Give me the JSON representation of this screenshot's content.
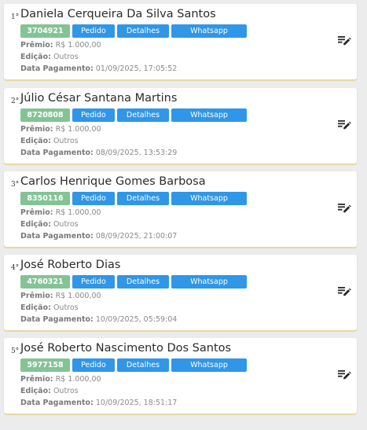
{
  "buttons": {
    "pedido": "Pedido",
    "detalhes": "Detalhes",
    "whatsapp": "Whatsapp"
  },
  "labels": {
    "premio": "Prêmio:",
    "edicao": "Edição:",
    "data_pagamento": "Data Pagamento:"
  },
  "colors": {
    "code_badge": "#83c395",
    "button": "#2f96e8",
    "card_bottom_border": "#e7d9a6"
  },
  "icons": {
    "edit": "playlist-edit-icon"
  },
  "winners": [
    {
      "rank": "1°",
      "name": "Daniela Cerqueira Da Silva Santos",
      "code": "3704921",
      "premio": "R$ 1.000,00",
      "edicao": "Outros",
      "data_pagamento": "01/09/2025, 17:05:52"
    },
    {
      "rank": "2°",
      "name": "Júlio César Santana Martins",
      "code": "8720808",
      "premio": "R$ 1.000,00",
      "edicao": "Outros",
      "data_pagamento": "08/09/2025, 13:53:29"
    },
    {
      "rank": "3°",
      "name": "Carlos Henrique Gomes Barbosa",
      "code": "8350116",
      "premio": "R$ 1.000,00",
      "edicao": "Outros",
      "data_pagamento": "08/09/2025, 21:00:07"
    },
    {
      "rank": "4°",
      "name": "José Roberto Dias",
      "code": "4760321",
      "premio": "R$ 1.000,00",
      "edicao": "Outros",
      "data_pagamento": "10/09/2025, 05:59:04"
    },
    {
      "rank": "5°",
      "name": "José Roberto Nascimento Dos Santos",
      "code": "5977158",
      "premio": "R$ 1.000,00",
      "edicao": "Outros",
      "data_pagamento": "10/09/2025, 18:51:17"
    }
  ]
}
